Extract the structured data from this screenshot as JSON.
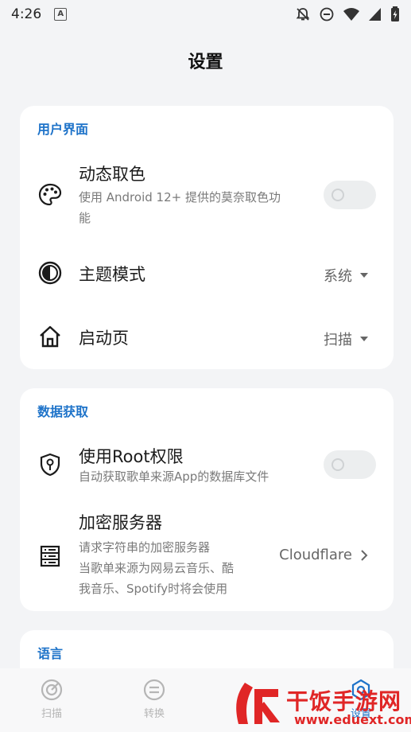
{
  "status_bar": {
    "time": "4:26",
    "a_icon": "A"
  },
  "page_title": "设置",
  "user_interface": {
    "section_title": "用户界面",
    "dynamic_color": {
      "title": "动态取色",
      "subtitle_line1": "使用 Android 12+ 提供的莫奈取色功",
      "subtitle_line2": "能",
      "enabled": false
    },
    "theme_mode": {
      "title": "主题模式",
      "value": "系统"
    },
    "start_page": {
      "title": "启动页",
      "value": "扫描"
    }
  },
  "data_fetch": {
    "section_title": "数据获取",
    "root": {
      "title": "使用Root权限",
      "subtitle": "自动获取歌单来源App的数据库文件",
      "enabled": false
    },
    "encrypt_server": {
      "title": "加密服务器",
      "subtitle_line1": "请求字符串的加密服务器",
      "subtitle_line2": "当歌单来源为网易云音乐、酷",
      "subtitle_line3": "我音乐、Spotify时将会使用",
      "value": "Cloudflare"
    }
  },
  "language": {
    "section_title": "语言"
  },
  "bottom_nav": {
    "scan": "扫描",
    "convert": "转换",
    "settings": "设置"
  },
  "watermark": {
    "text": "干饭手游网",
    "url": "www.eduext.com"
  },
  "colors": {
    "accent": "#1e73c9",
    "background": "#f3f4f6",
    "watermark": "#e02626"
  }
}
